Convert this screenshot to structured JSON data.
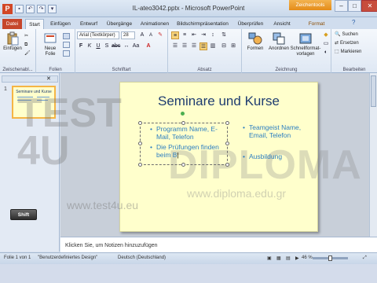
{
  "app": {
    "window_title": "IL-ateo3042.pptx - Microsoft PowerPoint",
    "context_tab_group": "Zeichentools",
    "logo_letter": "P"
  },
  "quick_access": {
    "save_icon": "save-icon",
    "undo_icon": "undo-icon",
    "redo_icon": "redo-icon"
  },
  "tabs": [
    {
      "label": "Datei"
    },
    {
      "label": "Start"
    },
    {
      "label": "Einfügen"
    },
    {
      "label": "Entwurf"
    },
    {
      "label": "Übergänge"
    },
    {
      "label": "Animationen"
    },
    {
      "label": "Bildschirmpräsentation"
    },
    {
      "label": "Überprüfen"
    },
    {
      "label": "Ansicht"
    },
    {
      "label": "Format"
    }
  ],
  "ribbon": {
    "clipboard": {
      "label": "Zwischenabl...",
      "paste": "Einfügen"
    },
    "slides": {
      "label": "Folien",
      "new_slide": "Neue Folie"
    },
    "font": {
      "label": "Schriftart",
      "font_name": "Arial (Textkörper)",
      "font_size": "28"
    },
    "paragraph": {
      "label": "Absatz"
    },
    "drawing": {
      "label": "Zeichnung",
      "shapes": "Formen",
      "arrange": "Anordnen",
      "quick_styles": "Schnellformat-vorlagen"
    },
    "editing": {
      "label": "Bearbeiten",
      "find": "Suchen",
      "replace": "Ersetzen",
      "select": "Markieren"
    }
  },
  "slide_panel": {
    "slide_number": "1",
    "thumb_title": "Seminare und Kurse"
  },
  "slide": {
    "title": "Seminare und Kurse",
    "left_bullets": [
      "Programm Name, E-Mail, Telefon",
      "Die Prüfungen finden beim B"
    ],
    "right_bullets": [
      "Teamgeist Name, Email, Telefon",
      "Ausbildung"
    ],
    "bullet_char": "•"
  },
  "watermark": {
    "left_big": "TEST\n4U",
    "left_url": "www.test4u.eu",
    "right_big": "DIPLOMA",
    "right_url": "www.diploma.edu.gr"
  },
  "shift_key": "Shift",
  "notes": {
    "placeholder": "Klicken Sie, um Notizen hinzuzufügen"
  },
  "statusbar": {
    "slide_info": "Folie 1 von 1",
    "theme": "\"Benutzerdefiniertes Design\"",
    "language": "Deutsch (Deutschland)",
    "zoom": "46 %"
  }
}
